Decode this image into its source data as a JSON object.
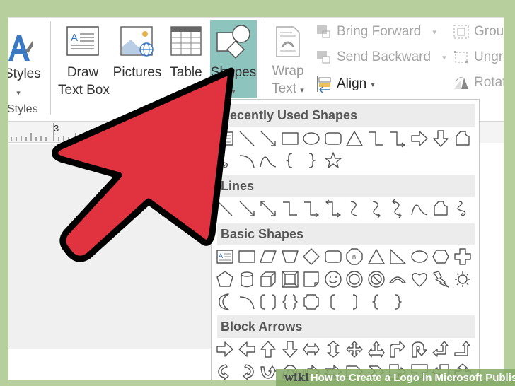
{
  "ribbon": {
    "styles_button": "Styles",
    "styles_group_label": "Styles",
    "draw_text_box_line1": "Draw",
    "draw_text_box_line2": "Text Box",
    "pictures": "Pictures",
    "table": "Table",
    "shapes": "Shapes",
    "wrap_text_line1": "Wrap",
    "wrap_text_line2": "Text",
    "bring_forward": "Bring Forward",
    "send_backward": "Send Backward",
    "align": "Align",
    "group": "Group",
    "ungroup": "Ungro",
    "rotate": "Rotat",
    "accent_color": "#8dc4be"
  },
  "ruler": {
    "marker": "3"
  },
  "shapes_menu": {
    "sections": [
      {
        "title": "Recently Used Shapes",
        "rows": [
          [
            "text-box",
            "line",
            "arrow-line",
            "rectangle",
            "oval",
            "rounded-rectangle",
            "triangle",
            "elbow-connector",
            "elbow-arrow-connector",
            "right-arrow",
            "down-arrow",
            "freeform"
          ],
          [
            "scribble",
            "arc",
            "curve",
            "left-brace",
            "right-brace",
            "star"
          ]
        ]
      },
      {
        "title": "Lines",
        "rows": [
          [
            "line",
            "arrow-line",
            "double-arrow-line",
            "elbow-connector",
            "elbow-arrow-connector",
            "elbow-double-arrow-connector",
            "curved-connector",
            "curved-arrow-connector",
            "curved-double-arrow-connector",
            "curve",
            "freeform",
            "scribble"
          ]
        ]
      },
      {
        "title": "Basic Shapes",
        "rows": [
          [
            "text-box",
            "rectangle",
            "parallelogram",
            "trapezoid",
            "diamond",
            "rounded-rectangle",
            "octagon",
            "triangle",
            "right-triangle",
            "oval",
            "hexagon",
            "cross"
          ],
          [
            "pentagon",
            "can",
            "cube",
            "bevel",
            "folded-corner",
            "smiley-face",
            "donut",
            "no-symbol",
            "block-arc",
            "heart",
            "lightning-bolt",
            "sun"
          ],
          [
            "moon",
            "arc",
            "double-bracket",
            "double-brace",
            "plaque",
            "left-bracket",
            "right-bracket",
            "left-brace",
            "right-brace"
          ]
        ]
      },
      {
        "title": "Block Arrows",
        "rows": [
          [
            "right-arrow",
            "left-arrow",
            "up-arrow",
            "down-arrow",
            "left-right-arrow",
            "up-down-arrow",
            "quad-arrow",
            "left-right-up-arrow",
            "bent-arrow",
            "u-turn-arrow",
            "left-up-arrow",
            "bent-up-arrow"
          ],
          [
            "curved-right-arrow",
            "curved-left-arrow",
            "curved-up-arrow",
            "curved-down-arrow",
            "striped-right-arrow",
            "notched-right-arrow",
            "pentagon-arrow",
            "chevron",
            "right-arrow-callout",
            "down-arrow-callout",
            "left-arrow-callout",
            "up-arrow-callout"
          ]
        ]
      }
    ]
  },
  "watermark": {
    "brand": "wiki",
    "title": "How to Create a Logo in Microsoft Publisher"
  },
  "annotation": {
    "pointer_color": "#e0323f"
  }
}
